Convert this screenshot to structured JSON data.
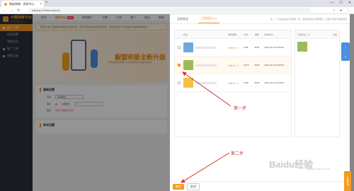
{
  "browser": {
    "tab_title": "铁赵商城 - 卖家中心",
    "url": "tuliaoty.1048a.cosiu/#/...",
    "new_tab": "+",
    "minimize": "—",
    "maximize": "☐",
    "close": "✕"
  },
  "sidebar": {
    "logo_text": "大橙商家平台",
    "logo_sub": "DAXICHENG",
    "items": [
      {
        "label": "推广工具",
        "active": true
      },
      {
        "label": "促销设置",
        "sub": true
      },
      {
        "label": "营销活动",
        "sub": true
      },
      {
        "label": "推广订单"
      },
      {
        "label": "收款记录"
      }
    ]
  },
  "topnav": {
    "items": [
      "首页",
      "插件中心",
      "营销推广",
      "设置",
      "订单",
      "客户",
      "商品",
      "数据"
    ],
    "active_badge": "NEW"
  },
  "main": {
    "notice": "【功能公告】商品橱窗功能现已全面升级，商家可通过后台设置展示商品，吸引更多客户关注店铺与商品的详细信息。",
    "banner_title": "橱窗明星全新升级",
    "banner_sub": "升级后的橱窗明星，展示更丰富的店铺商品信息",
    "basic_card_title": "基础设置",
    "basic_rows": [
      {
        "label": "名称",
        "value": "商品橱窗"
      },
      {
        "label": "展示",
        "radio": "全部展示",
        "value": "5"
      },
      {
        "label": "链接",
        "link": "查看 商品橱窗 示例"
      }
    ],
    "second_card_title": "样式设置"
  },
  "drawer": {
    "tabs": [
      "全部商品",
      "已选商品 (1)"
    ],
    "note": "注：一个商品最多只能选择一次，选择后将会在顶部展示，已推广商品不能再选择",
    "columns": [
      "商品",
      "推荐指数",
      "价格",
      "销量",
      "发布时间"
    ],
    "rows": [
      {
        "checked": false,
        "price": "1158",
        "sales": "8660",
        "time": "2022-04-25 00:00:00",
        "thumb": "#6fa8dc"
      },
      {
        "checked": true,
        "price": "11175",
        "sales": "6848",
        "time": "2022-04-25 00:00:00",
        "thumb": "#9bbb59"
      },
      {
        "checked": false,
        "price": "1308",
        "sales": "8606",
        "time": "2022-04-25 00:00:00",
        "thumb": "#f7c043"
      }
    ],
    "right_panel_title": "已选商品（1）",
    "right_panel_action": "清空",
    "step1": "第一步",
    "step2": "第二步",
    "ok_label": "确定",
    "cancel_label": "取消",
    "float_icons": [
      "↑",
      "⌂"
    ],
    "chat_label": "在线咨询"
  },
  "watermark": {
    "text": "Baidu经验",
    "sub": "jingyan.baidu.com"
  },
  "colors": {
    "accent": "#f59a23",
    "annotation": "#d9302c",
    "sidebar_bg": "#2a2f3a"
  }
}
